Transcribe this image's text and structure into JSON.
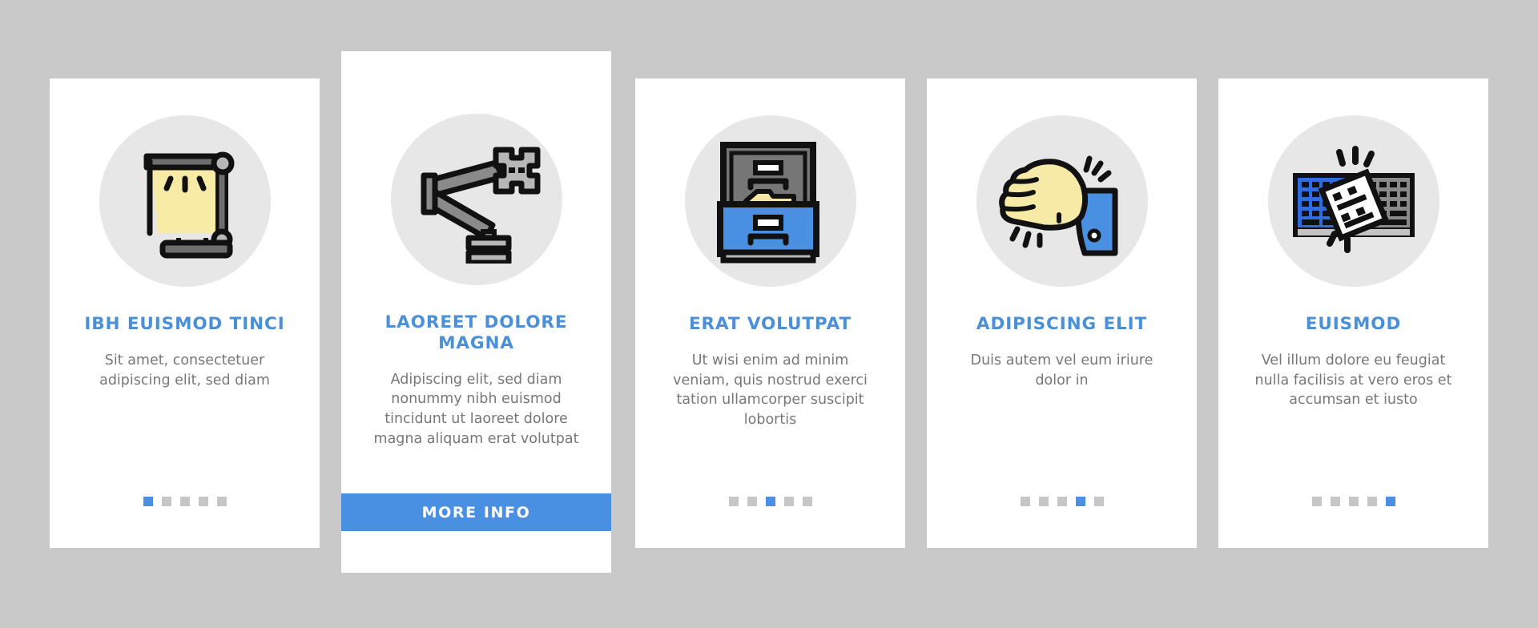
{
  "page": {
    "background_color": "#c9c9c9",
    "card_background": "#ffffff",
    "accent_color": "#4a90e2",
    "title_color": "#4a90d9",
    "body_color": "#77777a",
    "icon_badge_color": "#e7e7e7",
    "dot_inactive_color": "#c6c6c6"
  },
  "cards": [
    {
      "id": "card-1",
      "icon": "desk-lamp-icon",
      "title": "IBH EUISMOD TINCI",
      "body": "Sit amet, consectetuer adipiscing elit, sed diam",
      "dots_total": 5,
      "dot_active_index": 1,
      "featured": false
    },
    {
      "id": "card-2",
      "icon": "monitor-arm-mount-icon",
      "title": "LAOREET DOLORE MAGNA",
      "body": "Adipiscing elit, sed diam nonummy nibh euismod tincidunt ut laoreet dolore magna aliquam erat volutpat",
      "dots_total": 5,
      "dot_active_index": 2,
      "featured": true,
      "button_label": "MORE INFO"
    },
    {
      "id": "card-3",
      "icon": "filing-cabinet-icon",
      "title": "ERAT VOLUTPAT",
      "body": "Ut wisi enim ad minim veniam, quis nostrud exerci tation ullamcorper suscipit lobortis",
      "dots_total": 5,
      "dot_active_index": 3,
      "featured": false
    },
    {
      "id": "card-4",
      "icon": "hand-squeezing-stress-ball-icon",
      "title": "ADIPISCING ELIT",
      "body": "Duis autem vel eum iriure dolor in",
      "dots_total": 5,
      "dot_active_index": 4,
      "featured": false
    },
    {
      "id": "card-5",
      "icon": "keyboard-cleaning-icon",
      "title": "EUISMOD",
      "body": "Vel illum dolore eu feugiat nulla facilisis at vero eros et accumsan et iusto",
      "dots_total": 5,
      "dot_active_index": 5,
      "featured": false
    }
  ]
}
